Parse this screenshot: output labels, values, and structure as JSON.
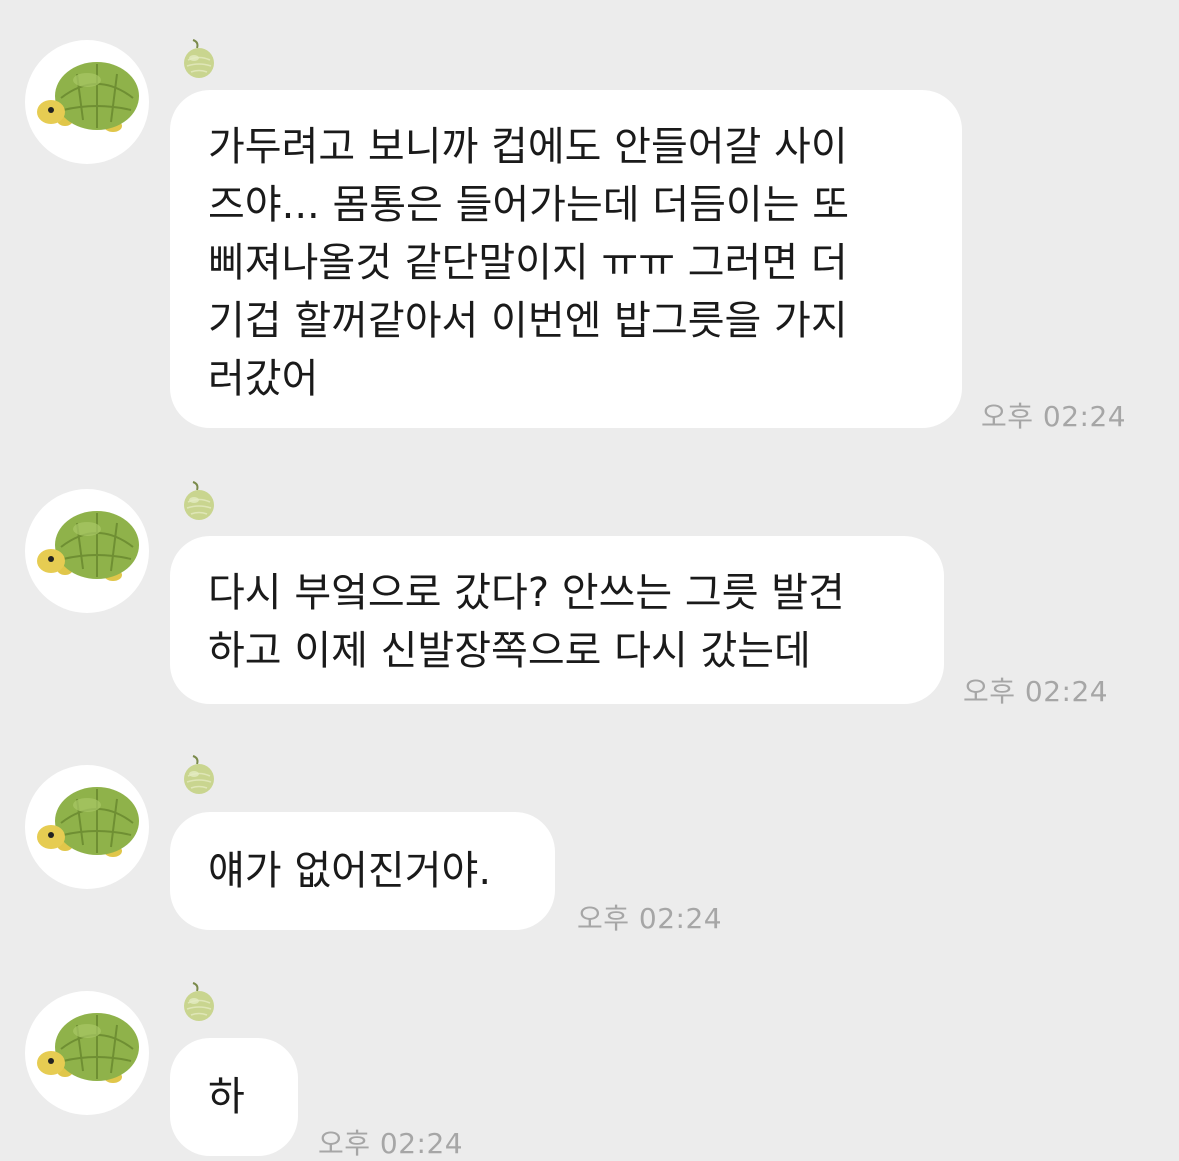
{
  "conversation": {
    "messages": [
      {
        "text": "가두려고 보니까 컵에도 안들어갈 사이\n즈야... 몸통은 들어가는데 더듬이는 또\n삐져나올것 같단말이지 ㅠㅠ 그러면 더\n기겁 할꺼같아서 이번엔 밥그릇을 가지\n러갔어",
        "time": "오후 02:24"
      },
      {
        "text": "다시 부엌으로 갔다? 안쓰는 그릇 발견\n하고 이제 신발장쪽으로 다시 갔는데",
        "time": "오후 02:24"
      },
      {
        "text": "얘가 없어진거야.",
        "time": "오후 02:24"
      },
      {
        "text": "하",
        "time": "오후 02:24"
      }
    ]
  },
  "colors": {
    "background": "#ececec",
    "bubble": "#ffffff",
    "text": "#1a1a1a",
    "timestamp": "#a6a6a6",
    "turtle_shell": "#8fb24a",
    "turtle_body": "#e3c94e",
    "melon": "#c9d58f"
  },
  "icons": {
    "avatar": "turtle-avatar-icon",
    "sender_badge": "melon-icon"
  }
}
